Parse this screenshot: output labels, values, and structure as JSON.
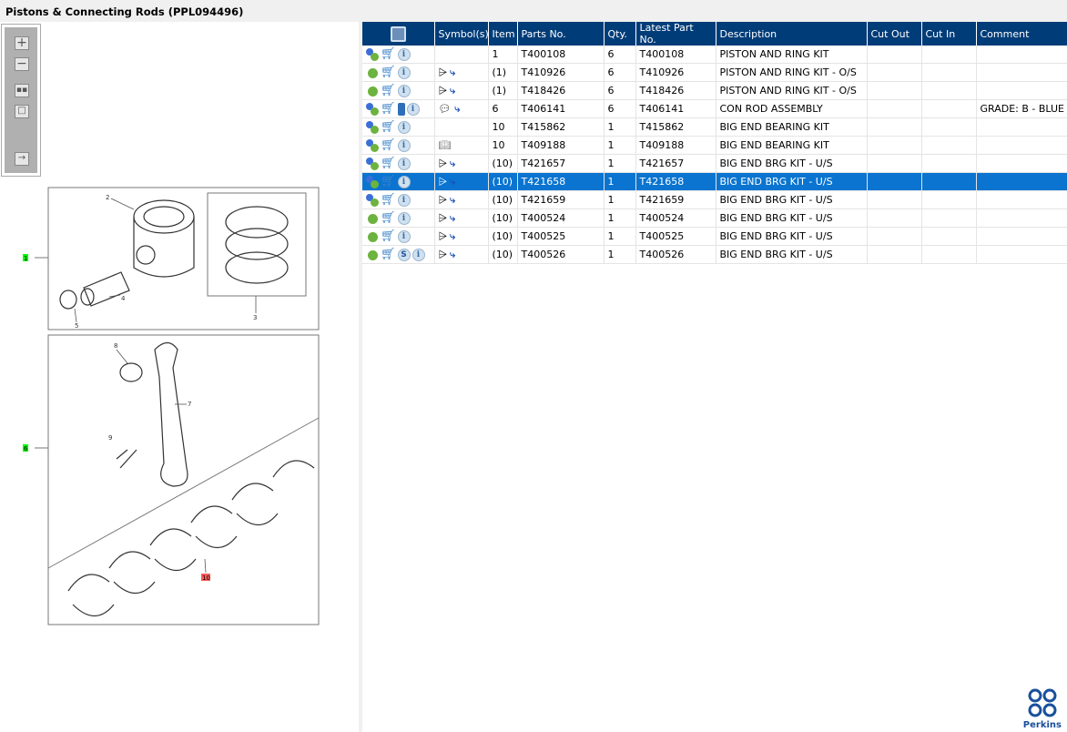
{
  "window": {
    "title": "Pistons & Connecting Rods (PPL094496)"
  },
  "toolbar": {
    "zoom_in": "zoom-in",
    "zoom_out": "zoom-out",
    "fit": "fit",
    "actual": "actual",
    "export": "export"
  },
  "diagram": {
    "callouts": [
      "1",
      "2",
      "3",
      "4",
      "5",
      "6",
      "7",
      "8",
      "9",
      "10"
    ]
  },
  "table": {
    "headers": [
      "",
      "Symbol(s)",
      "Item",
      "Parts No.",
      "Qty.",
      "Latest Part No.",
      "Description",
      "Cut Out",
      "Cut In",
      "Comment"
    ],
    "rows": [
      {
        "icons": [
          "gears",
          "cart",
          "info"
        ],
        "symbols": "",
        "item": "1",
        "part": "T400108",
        "qty": "6",
        "latest": "T400108",
        "desc": "PISTON AND RING KIT",
        "cutout": "",
        "cutin": "",
        "comment": ""
      },
      {
        "icons": [
          "gear",
          "cart",
          "info"
        ],
        "symbols": "alt",
        "item": "(1)",
        "part": "T410926",
        "qty": "6",
        "latest": "T410926",
        "desc": "PISTON AND RING KIT - O/S",
        "cutout": "",
        "cutin": "",
        "comment": ""
      },
      {
        "icons": [
          "gear",
          "cart",
          "info"
        ],
        "symbols": "alt",
        "item": "(1)",
        "part": "T418426",
        "qty": "6",
        "latest": "T418426",
        "desc": "PISTON AND RING KIT - O/S",
        "cutout": "",
        "cutin": "",
        "comment": ""
      },
      {
        "icons": [
          "gears",
          "cart",
          "book",
          "info"
        ],
        "symbols": "note",
        "item": "6",
        "part": "T406141",
        "qty": "6",
        "latest": "T406141",
        "desc": "CON ROD ASSEMBLY",
        "cutout": "",
        "cutin": "",
        "comment": "GRADE: B - BLUE"
      },
      {
        "icons": [
          "gears",
          "cart",
          "info"
        ],
        "symbols": "",
        "item": "10",
        "part": "T415862",
        "qty": "1",
        "latest": "T415862",
        "desc": "BIG END BEARING KIT",
        "cutout": "",
        "cutin": "",
        "comment": ""
      },
      {
        "icons": [
          "gears",
          "cart",
          "info"
        ],
        "symbols": "manual",
        "item": "10",
        "part": "T409188",
        "qty": "1",
        "latest": "T409188",
        "desc": "BIG END BEARING KIT",
        "cutout": "",
        "cutin": "",
        "comment": ""
      },
      {
        "icons": [
          "gears",
          "cart",
          "info"
        ],
        "symbols": "alt",
        "item": "(10)",
        "part": "T421657",
        "qty": "1",
        "latest": "T421657",
        "desc": "BIG END BRG KIT - U/S",
        "cutout": "",
        "cutin": "",
        "comment": ""
      },
      {
        "icons": [
          "gears",
          "cart",
          "info"
        ],
        "symbols": "alt",
        "item": "(10)",
        "part": "T421658",
        "qty": "1",
        "latest": "T421658",
        "desc": "BIG END BRG KIT - U/S",
        "cutout": "",
        "cutin": "",
        "comment": "",
        "selected": true
      },
      {
        "icons": [
          "gears",
          "cart",
          "info"
        ],
        "symbols": "alt",
        "item": "(10)",
        "part": "T421659",
        "qty": "1",
        "latest": "T421659",
        "desc": "BIG END BRG KIT - U/S",
        "cutout": "",
        "cutin": "",
        "comment": ""
      },
      {
        "icons": [
          "gear",
          "cart",
          "info"
        ],
        "symbols": "alt",
        "item": "(10)",
        "part": "T400524",
        "qty": "1",
        "latest": "T400524",
        "desc": "BIG END BRG KIT - U/S",
        "cutout": "",
        "cutin": "",
        "comment": ""
      },
      {
        "icons": [
          "gear",
          "cart",
          "info"
        ],
        "symbols": "alt",
        "item": "(10)",
        "part": "T400525",
        "qty": "1",
        "latest": "T400525",
        "desc": "BIG END BRG KIT - U/S",
        "cutout": "",
        "cutin": "",
        "comment": ""
      },
      {
        "icons": [
          "gear",
          "cart",
          "s",
          "info"
        ],
        "symbols": "alt",
        "item": "(10)",
        "part": "T400526",
        "qty": "1",
        "latest": "T400526",
        "desc": "BIG END BRG KIT - U/S",
        "cutout": "",
        "cutin": "",
        "comment": ""
      }
    ]
  },
  "logo": {
    "text": "Perkins"
  },
  "colors": {
    "header": "#003c78",
    "selected": "#0a74d0",
    "hotspot_green": "#00ff00",
    "hotspot_red": "#ff5a5a"
  }
}
